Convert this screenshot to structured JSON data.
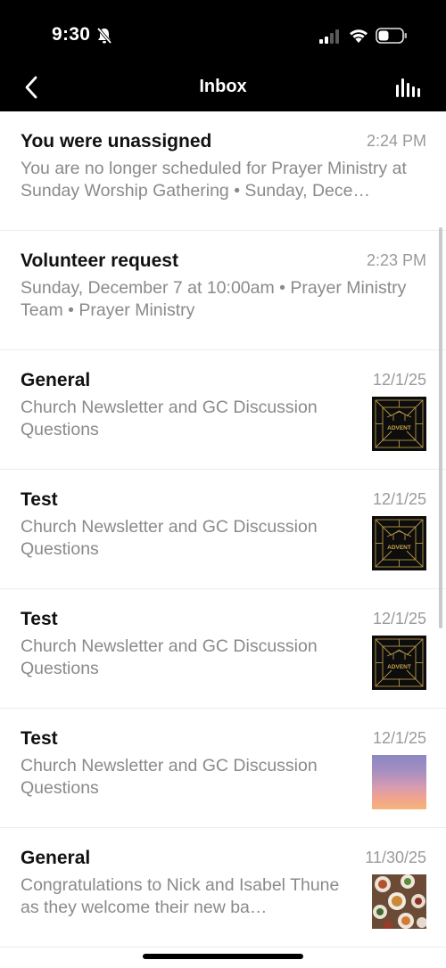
{
  "status": {
    "time": "9:30"
  },
  "nav": {
    "title": "Inbox"
  },
  "messages": [
    {
      "title": "You were unassigned",
      "time": "2:24 PM",
      "body": "You are no longer scheduled for Prayer Ministry at Sunday Worship Gathering • Sunday, Dece…"
    },
    {
      "title": "Volunteer request",
      "time": "2:23 PM",
      "body": "Sunday, December 7 at 10:00am • Prayer Ministry Team • Prayer Ministry"
    },
    {
      "title": "General",
      "time": "12/1/25",
      "body": "Church Newsletter and GC Discussion Questions",
      "thumb": "advent-graphic",
      "thumb_text": "ADVENT"
    },
    {
      "title": "Test",
      "time": "12/1/25",
      "body": "Church Newsletter and GC Discussion Questions",
      "thumb": "advent-graphic",
      "thumb_text": "ADVENT"
    },
    {
      "title": "Test",
      "time": "12/1/25",
      "body": "Church Newsletter and GC Discussion Questions",
      "thumb": "advent-graphic",
      "thumb_text": "ADVENT"
    },
    {
      "title": "Test",
      "time": "12/1/25",
      "body": "Church Newsletter and GC Discussion Questions",
      "thumb": "sunset-photo"
    },
    {
      "title": "General",
      "time": "11/30/25",
      "body": "Congratulations to Nick and Isabel Thune as they welcome their new ba…",
      "thumb": "food-table-photo"
    }
  ],
  "icons": {
    "back": "chevron-left-icon",
    "filter": "bar-chart-icon",
    "silent": "bell-slash-icon",
    "signal": "cellular-signal-icon",
    "wifi": "wifi-icon",
    "battery": "battery-icon"
  },
  "colors": {
    "header_bg": "#000000",
    "title_text": "#111111",
    "secondary_text": "#8a8a8a",
    "timestamp": "#9a9a9a",
    "advent_gold": "#c9a24a"
  }
}
